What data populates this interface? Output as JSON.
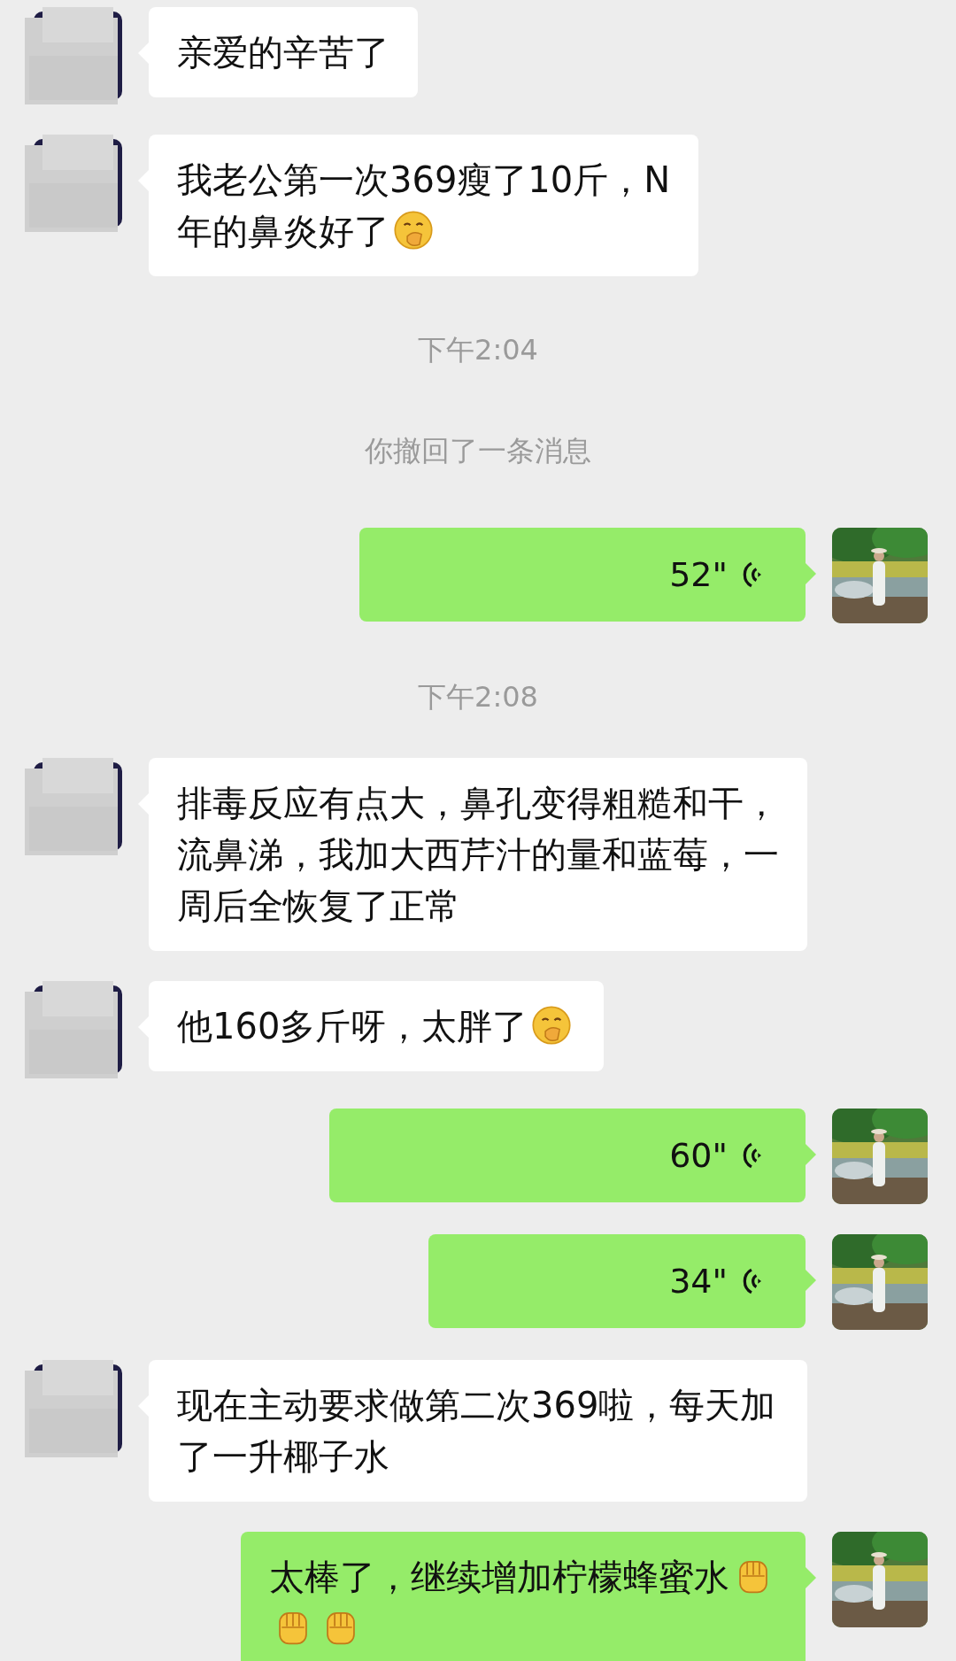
{
  "messages": [
    {
      "kind": "text",
      "outgoing": false,
      "parts": [
        {
          "kind": "text",
          "text": "亲爱的辛苦了"
        }
      ]
    },
    {
      "kind": "text",
      "outgoing": false,
      "parts": [
        {
          "kind": "text",
          "text": "我老公第一次369瘦了10斤，N"
        },
        {
          "kind": "break"
        },
        {
          "kind": "text",
          "text": "年的鼻炎好了"
        },
        {
          "kind": "giggle"
        }
      ]
    },
    {
      "kind": "time",
      "text": "下午2:04"
    },
    {
      "kind": "system",
      "text": "你撤回了一条消息"
    },
    {
      "kind": "voice",
      "outgoing": true,
      "duration": "52\""
    },
    {
      "kind": "time",
      "text": "下午2:08"
    },
    {
      "kind": "text",
      "outgoing": false,
      "parts": [
        {
          "kind": "text",
          "text": "排毒反应有点大，鼻孔变得粗糙和干，流鼻涕，我加大西芹汁的量和蓝莓，一周后全恢复了正常"
        }
      ]
    },
    {
      "kind": "text",
      "outgoing": false,
      "parts": [
        {
          "kind": "text",
          "text": "他160多斤呀，太胖了"
        },
        {
          "kind": "giggle"
        }
      ]
    },
    {
      "kind": "voice",
      "outgoing": true,
      "duration": "60\""
    },
    {
      "kind": "voice",
      "outgoing": true,
      "duration": "34\""
    },
    {
      "kind": "text",
      "outgoing": false,
      "parts": [
        {
          "kind": "text",
          "text": "现在主动要求做第二次369啦，每天加了一升椰子水"
        }
      ]
    },
    {
      "kind": "text",
      "outgoing": true,
      "parts": [
        {
          "kind": "text",
          "text": "太棒了，继续增加柠檬蜂蜜水"
        },
        {
          "kind": "fist"
        },
        {
          "kind": "break"
        },
        {
          "kind": "fist"
        },
        {
          "kind": "fist"
        }
      ]
    }
  ]
}
